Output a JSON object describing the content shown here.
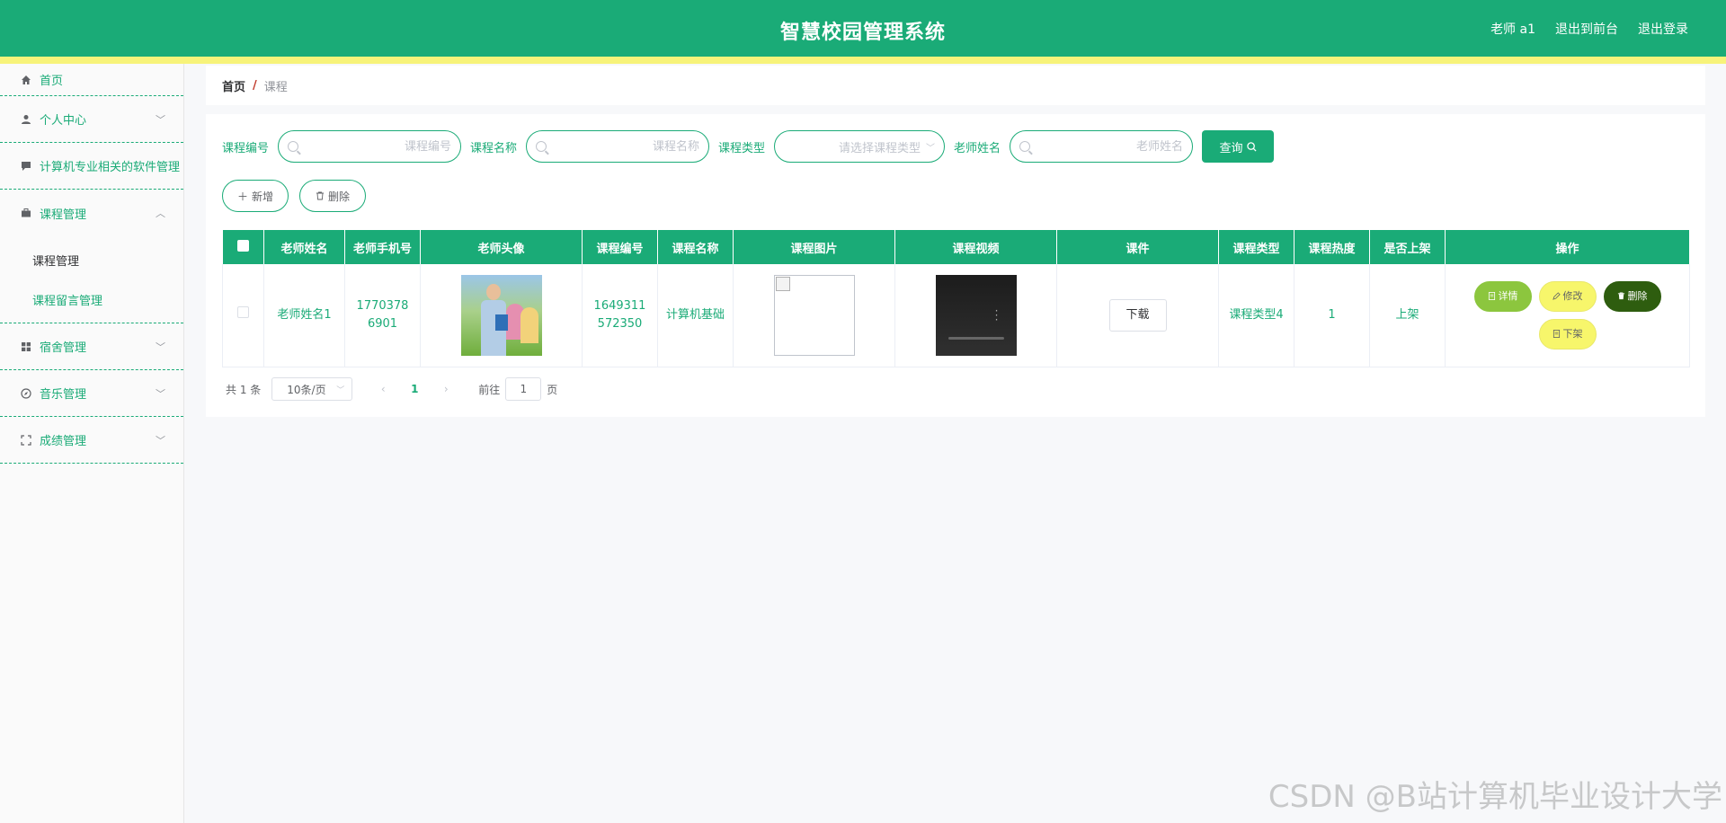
{
  "header": {
    "title": "智慧校园管理系统",
    "user": "老师 a1",
    "back_to_front": "退出到前台",
    "logout": "退出登录"
  },
  "sidebar": {
    "items": [
      {
        "label": "首页",
        "icon": "home-icon"
      },
      {
        "label": "个人中心",
        "icon": "user-icon"
      },
      {
        "label": "计算机专业相关的软件管理",
        "icon": "chat-icon"
      },
      {
        "label": "课程管理",
        "icon": "briefcase-icon",
        "expanded": true,
        "children": [
          {
            "label": "课程管理",
            "active": true
          },
          {
            "label": "课程留言管理"
          }
        ]
      },
      {
        "label": "宿舍管理",
        "icon": "grid-icon"
      },
      {
        "label": "音乐管理",
        "icon": "compass-icon"
      },
      {
        "label": "成绩管理",
        "icon": "fullscreen-icon"
      }
    ]
  },
  "breadcrumb": {
    "home": "首页",
    "separator": "/",
    "current": "课程"
  },
  "search": {
    "course_no_label": "课程编号",
    "course_no_placeholder": "课程编号",
    "course_name_label": "课程名称",
    "course_name_placeholder": "课程名称",
    "course_type_label": "课程类型",
    "course_type_placeholder": "请选择课程类型",
    "teacher_label": "老师姓名",
    "teacher_placeholder": "老师姓名",
    "query_label": "查询"
  },
  "actions": {
    "add_label": "新增",
    "delete_label": "删除"
  },
  "table": {
    "headers": [
      "老师姓名",
      "老师手机号",
      "老师头像",
      "课程编号",
      "课程名称",
      "课程图片",
      "课程视频",
      "课件",
      "课程类型",
      "课程热度",
      "是否上架",
      "操作"
    ],
    "rows": [
      {
        "teacher_name": "老师姓名1",
        "teacher_phone": "17703786901",
        "course_no": "1649311572350",
        "course_name": "计算机基础",
        "courseware": "下载",
        "course_type": "课程类型4",
        "heat": "1",
        "on_shelf": "上架",
        "ops": {
          "detail": "详情",
          "edit": "修改",
          "delete": "删除",
          "off_shelf": "下架"
        }
      }
    ]
  },
  "pagination": {
    "total": "共 1 条",
    "page_size": "10条/页",
    "current_page": "1",
    "goto_prefix": "前往",
    "goto_value": "1",
    "goto_suffix": "页"
  },
  "watermark": "CSDN @B站计算机毕业设计大学",
  "colors": {
    "primary": "#1aab77",
    "stripe": "#f7f37a",
    "detail": "#8cc63e",
    "edit": "#f7f66b",
    "delete": "#2e5d0f"
  }
}
